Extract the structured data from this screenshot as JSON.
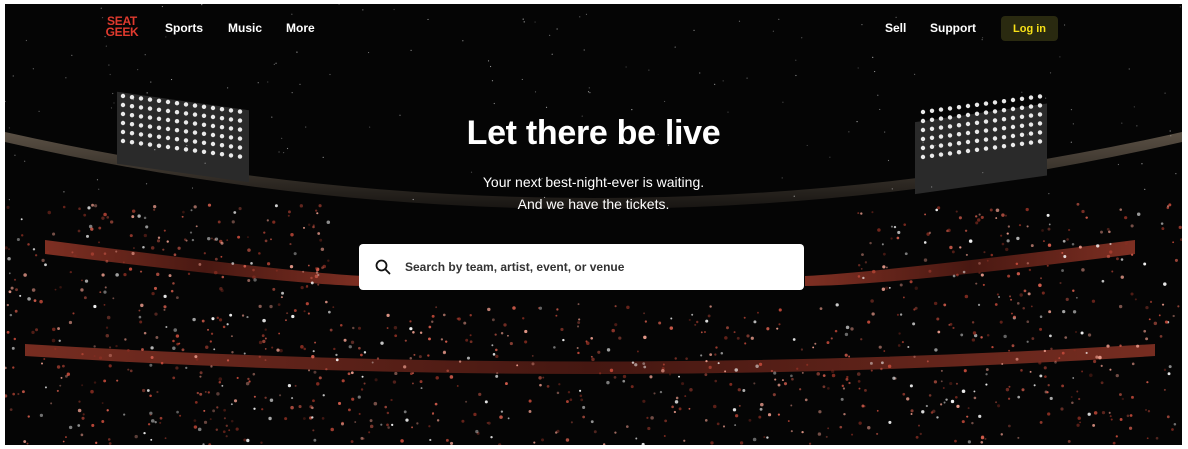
{
  "logo": {
    "line1": "SEAT",
    "line2": "GEEK"
  },
  "nav": {
    "left": [
      "Sports",
      "Music",
      "More"
    ],
    "sell": "Sell",
    "support": "Support",
    "login": "Log in"
  },
  "hero": {
    "title": "Let there be live",
    "subtitle_line1": "Your next best-night-ever is waiting.",
    "subtitle_line2": "And we have the tickets."
  },
  "search": {
    "placeholder": "Search by team, artist, event, or venue",
    "icon": "search-icon"
  },
  "colors": {
    "brand_red": "#e03a2e",
    "login_text": "#f7e017",
    "background": "#050505",
    "crowd_accent": "#d9604f"
  }
}
